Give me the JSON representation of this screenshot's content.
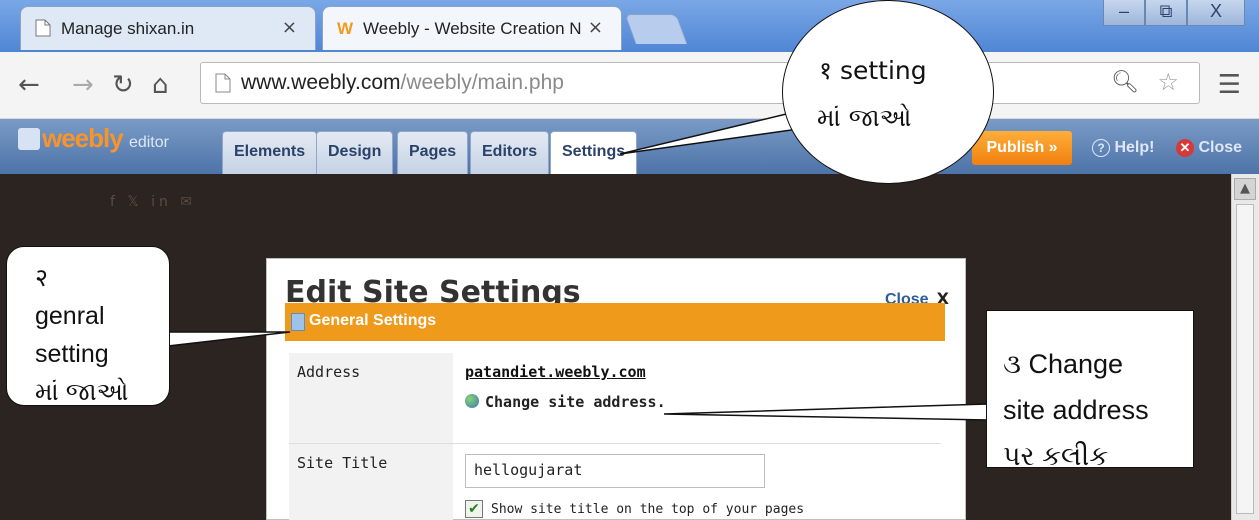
{
  "browser": {
    "tabs": [
      {
        "title": "Manage shixan.in",
        "close": "×"
      },
      {
        "title": "Weebly - Website Creation N",
        "close": "×"
      }
    ],
    "window_controls": {
      "minimize": "–",
      "restore": "⧉",
      "close": "X"
    },
    "url_host": "www.weebly.com",
    "url_path": "/weebly/main.php"
  },
  "editor": {
    "logo": "weebly",
    "logo_suffix": "editor",
    "tabs": [
      "Elements",
      "Design",
      "Pages",
      "Editors",
      "Settings"
    ],
    "active_tab": "Settings",
    "publish_label": "Publish »",
    "help_label": "Help!",
    "close_label": "Close"
  },
  "dialog": {
    "title": "Edit Site Settings",
    "close_label": "Close",
    "close_x": "X",
    "section_label": "General Settings",
    "address_label": "Address",
    "address_value": "patandiet.weebly.com",
    "change_address_label": "Change site address.",
    "site_title_label": "Site Title",
    "site_title_value": "hellogujarat",
    "show_title_label": "Show site title on the top of your pages"
  },
  "callouts": {
    "one_line1": "१ setting",
    "one_line2": "માં જાઓ",
    "two_line1": "२",
    "two_line2": "genral",
    "two_line3": "setting",
    "two_line4": "માં જાઓ",
    "three_line1": "૩ Change",
    "three_line2": "site address",
    "three_line3": "પર કલીક"
  },
  "colors": {
    "accent_orange": "#f09a1c",
    "editor_bar_blue": "#4d73a8",
    "publish_orange": "#f0800f"
  }
}
